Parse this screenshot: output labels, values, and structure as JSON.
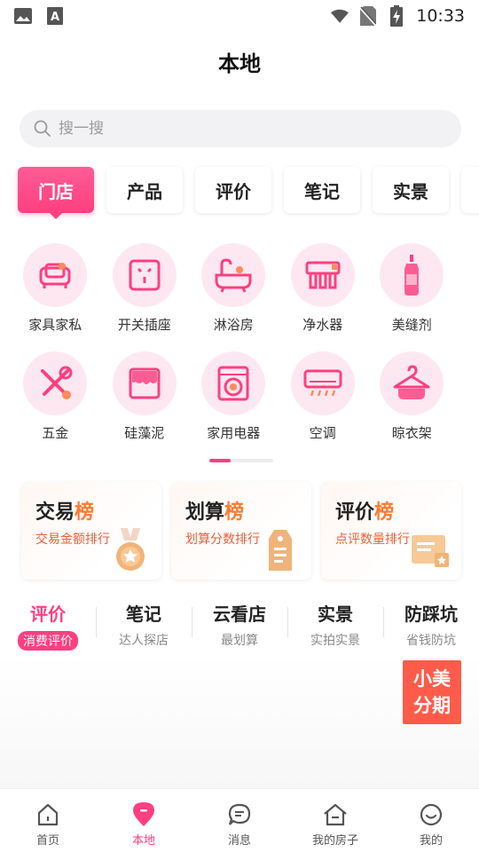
{
  "status_bar": {
    "time": "10:33"
  },
  "page_title": "本地",
  "search": {
    "placeholder": "搜一搜"
  },
  "category_tabs": [
    {
      "label": "门店",
      "active": true
    },
    {
      "label": "产品"
    },
    {
      "label": "评价"
    },
    {
      "label": "笔记"
    },
    {
      "label": "实景"
    },
    {
      "label": ""
    }
  ],
  "grid_items": [
    {
      "label": "家具家私",
      "icon": "sofa-icon"
    },
    {
      "label": "开关插座",
      "icon": "socket-icon"
    },
    {
      "label": "淋浴房",
      "icon": "bathtub-icon"
    },
    {
      "label": "净水器",
      "icon": "water-purifier-icon"
    },
    {
      "label": "美缝剂",
      "icon": "sealant-bottle-icon"
    },
    {
      "label": "五金",
      "icon": "tools-icon"
    },
    {
      "label": "硅藻泥",
      "icon": "wall-paint-icon"
    },
    {
      "label": "家用电器",
      "icon": "washing-machine-icon"
    },
    {
      "label": "空调",
      "icon": "air-conditioner-icon"
    },
    {
      "label": "晾衣架",
      "icon": "clothes-hanger-icon"
    }
  ],
  "rank_cards": [
    {
      "title_main": "交易",
      "title_accent": "榜",
      "subtitle": "交易金额排行"
    },
    {
      "title_main": "划算",
      "title_accent": "榜",
      "subtitle": "划算分数排行"
    },
    {
      "title_main": "评价",
      "title_accent": "榜",
      "subtitle": "点评数量排行"
    }
  ],
  "feature_tabs": [
    {
      "main": "评价",
      "sub": "消费评价",
      "active": true
    },
    {
      "main": "笔记",
      "sub": "达人探店"
    },
    {
      "main": "云看店",
      "sub": "最划算"
    },
    {
      "main": "实景",
      "sub": "实拍实景"
    },
    {
      "main": "防踩坑",
      "sub": "省钱防坑"
    }
  ],
  "promo": {
    "line1": "小美",
    "line2": "分期"
  },
  "bottom_nav": [
    {
      "label": "首页",
      "icon": "home-icon"
    },
    {
      "label": "本地",
      "icon": "location-pin-icon",
      "active": true
    },
    {
      "label": "消息",
      "icon": "message-icon"
    },
    {
      "label": "我的房子",
      "icon": "my-house-icon"
    },
    {
      "label": "我的",
      "icon": "profile-icon"
    }
  ],
  "colors": {
    "accent": "#ff3f7f",
    "icon_bg": "#fde8f1",
    "rank_accent": "#ff7a2e",
    "promo": "#ff5b4a"
  }
}
